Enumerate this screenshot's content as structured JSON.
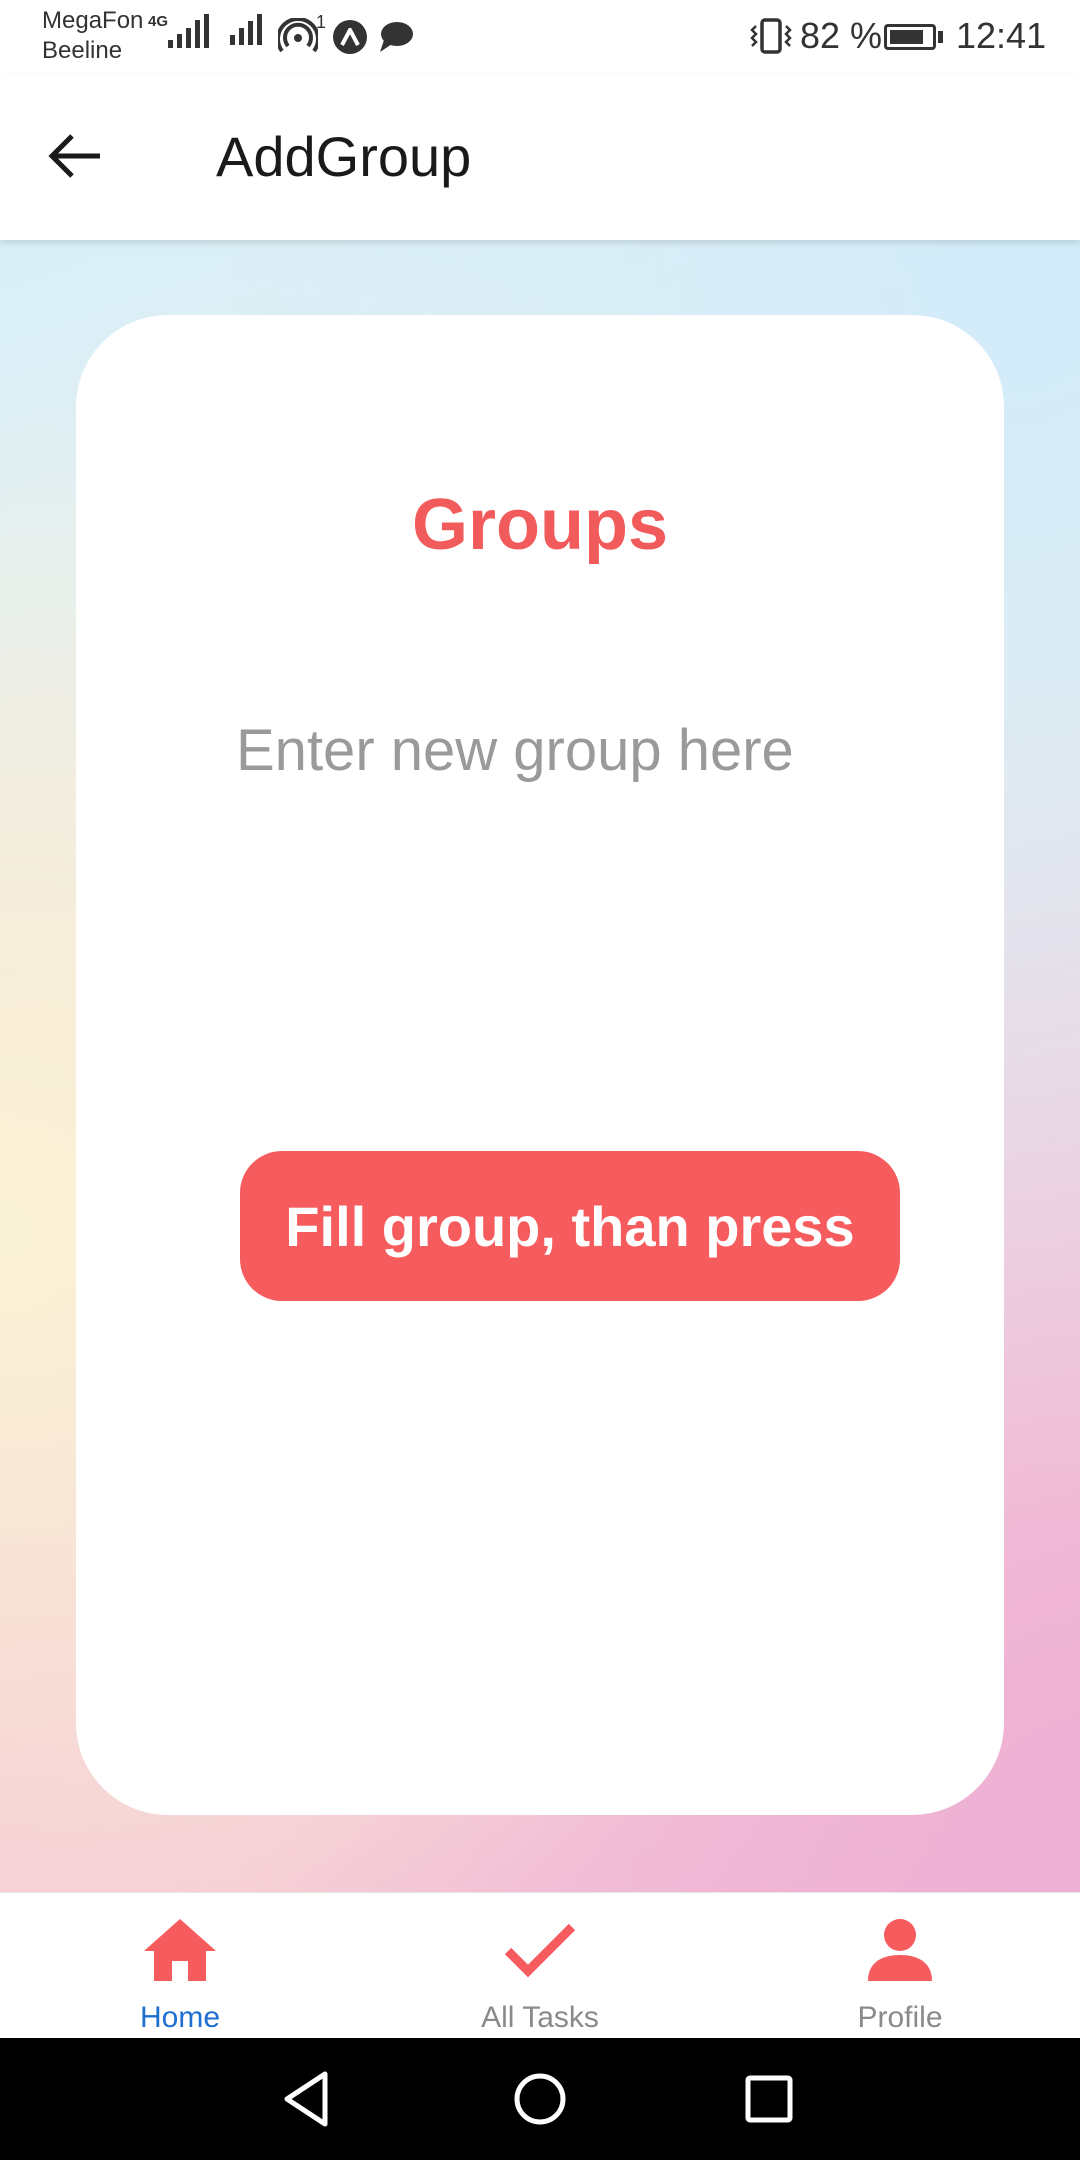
{
  "status_bar": {
    "carrier_1": "MegaFon",
    "carrier_2": "Beeline",
    "network_type": "4G",
    "hotspot_count": "1",
    "battery_percent": "82 %",
    "battery_level": 0.82,
    "time": "12:41"
  },
  "app_bar": {
    "title": "AddGroup",
    "back_icon": "arrow-left-icon"
  },
  "card": {
    "title": "Groups",
    "input": {
      "value": "",
      "placeholder": "Enter new group here"
    },
    "submit_label": "Fill group, than press"
  },
  "tab_bar": {
    "tabs": [
      {
        "label": "Home",
        "icon": "home-icon",
        "active": true
      },
      {
        "label": "All Tasks",
        "icon": "check-icon",
        "active": false
      },
      {
        "label": "Profile",
        "icon": "person-icon",
        "active": false
      }
    ]
  },
  "system_nav": {
    "buttons": [
      "back-triangle-icon",
      "home-circle-icon",
      "recents-square-icon"
    ]
  },
  "colors": {
    "accent": "#f65b5e",
    "active_tab": "#1e6fd0",
    "inactive_tab": "#8a8a8a"
  }
}
